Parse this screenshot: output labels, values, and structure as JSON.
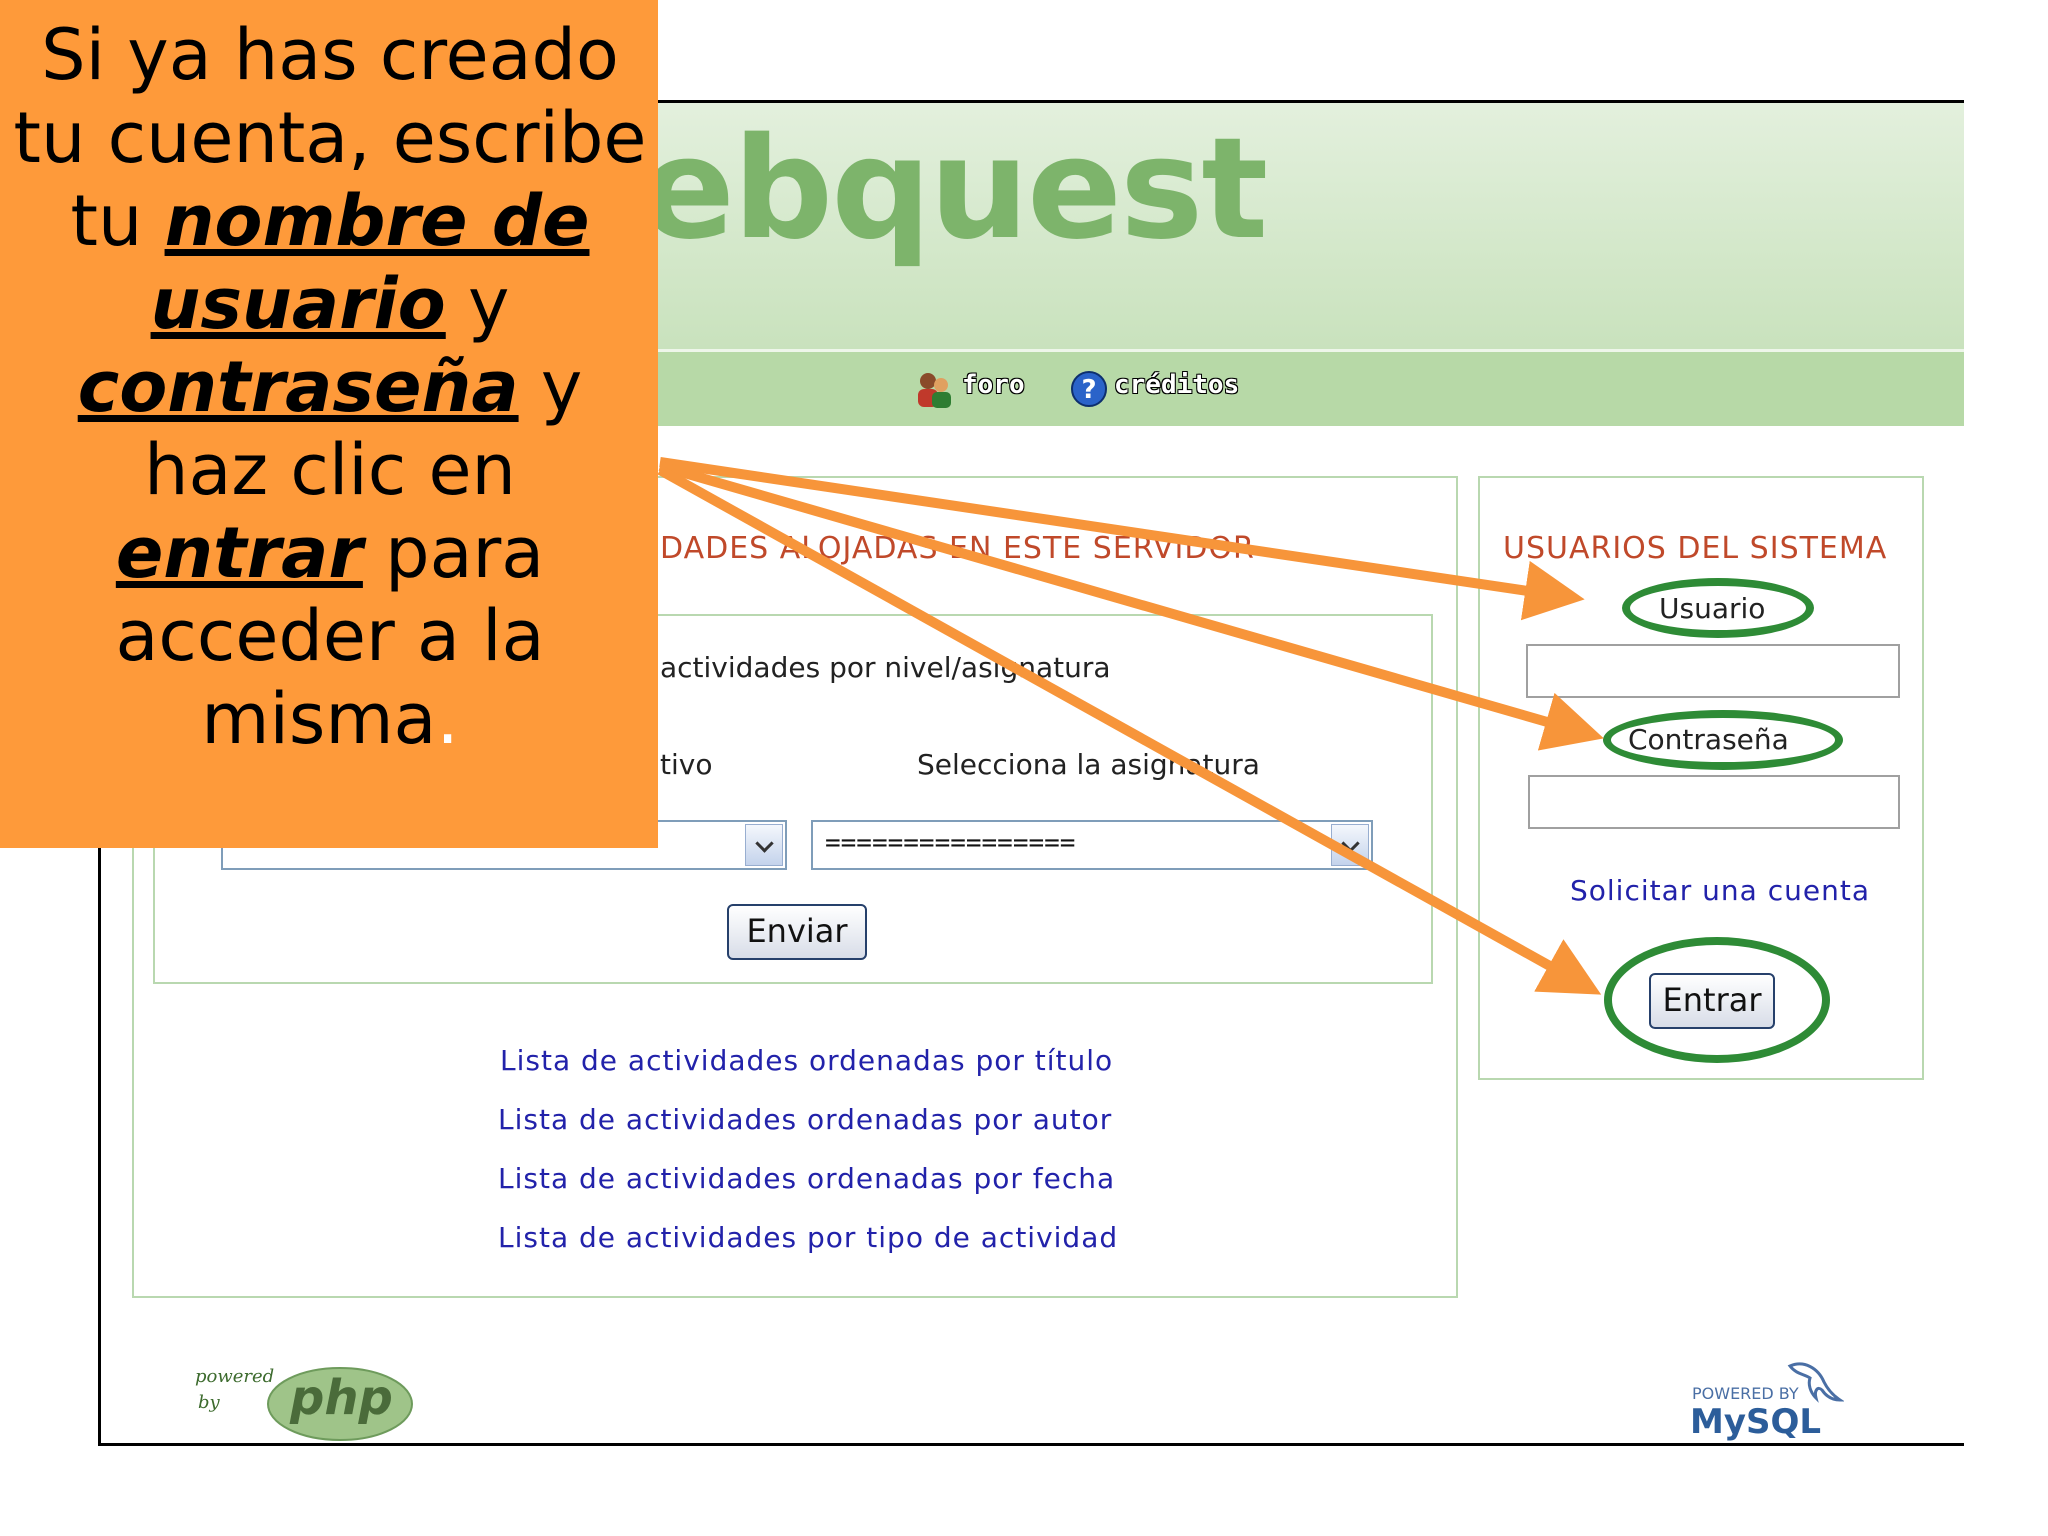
{
  "header": {
    "logo_text": "ebquest"
  },
  "nav": {
    "foro_label": "foro",
    "creditos_label": "créditos"
  },
  "main": {
    "section_title": "DADES ALOJADAS EN ESTE SERVIDOR",
    "filter_heading": "actividades por nivel/asignatura",
    "level_label": "tivo",
    "subject_label": "Selecciona la asignatura",
    "subject_select_value": "================",
    "submit_label": "Enviar",
    "links": [
      "Lista de actividades ordenadas por título",
      "Lista de actividades ordenadas por autor",
      "Lista de actividades ordenadas por fecha",
      "Lista de actividades por tipo de actividad"
    ]
  },
  "users": {
    "title": "USUARIOS DEL SISTEMA",
    "username_label": "Usuario",
    "password_label": "Contraseña",
    "request_account_label": "Solicitar una cuenta",
    "login_label": "Entrar"
  },
  "footer": {
    "php_powered": "powered",
    "php_by": "by",
    "php_logo": "php",
    "mysql_powered": "POWERED BY",
    "mysql_logo": "MySQL"
  },
  "callout": {
    "line1": "Si ya has creado tu cuenta, escribe tu ",
    "em1": "nombre de usuario",
    "line2": " y ",
    "em2": "contraseña",
    "line3": " y haz clic en ",
    "em3": "entrar",
    "line4": " para acceder a la misma",
    "dot": "."
  },
  "colors": {
    "callout_bg": "#fe9a3a",
    "arrow": "#f7953a",
    "highlight_oval": "#2e8b36",
    "header_green": "#b7d9a7",
    "title_red": "#c0492a",
    "link_blue": "#2222aa"
  }
}
